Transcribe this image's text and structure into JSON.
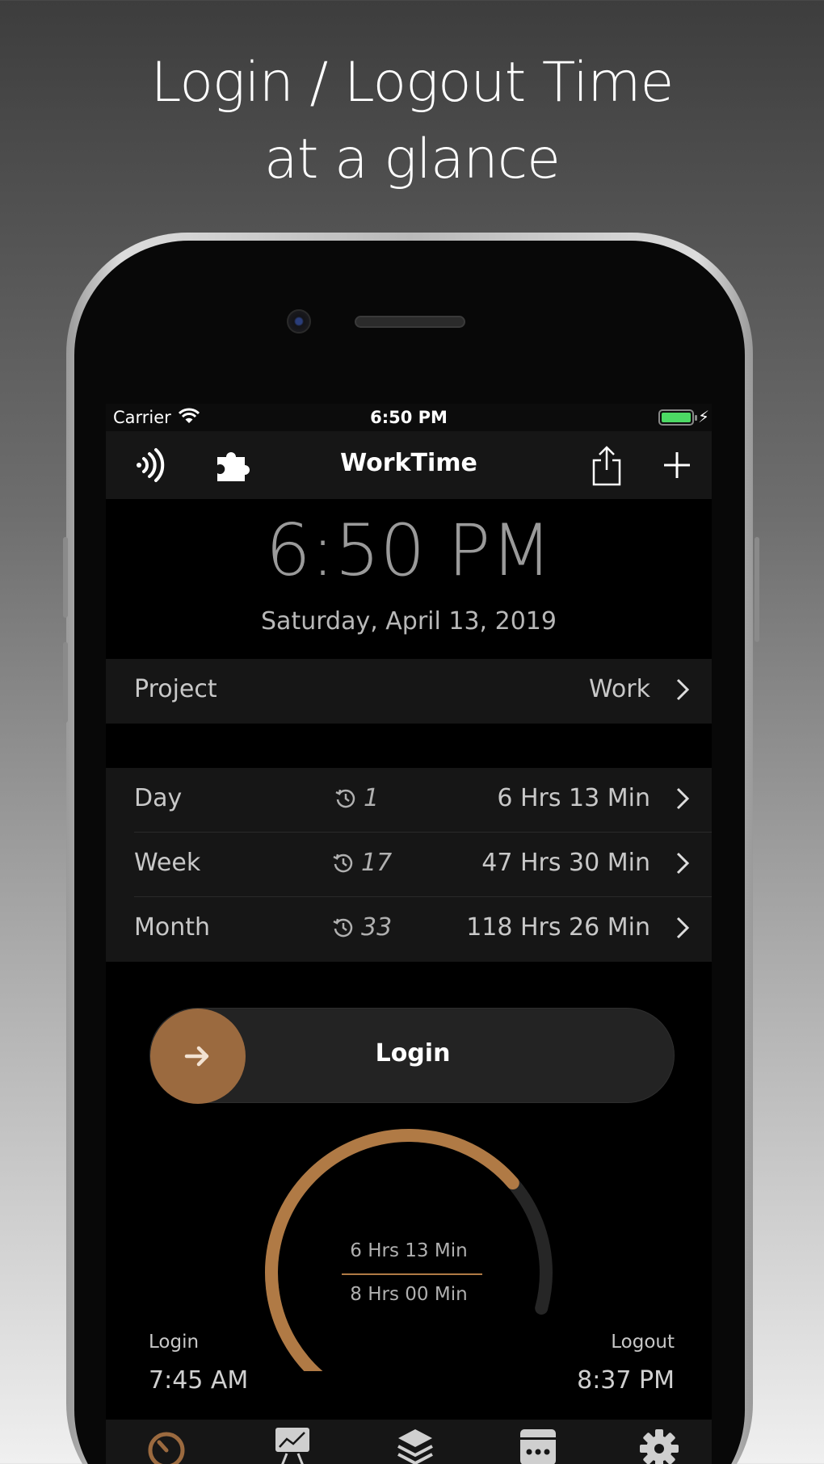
{
  "headline": {
    "line1": "Login / Logout Time",
    "line2": "at a glance"
  },
  "status_bar": {
    "carrier": "Carrier",
    "time": "6:50 PM"
  },
  "nav": {
    "title": "WorkTime",
    "left_icons": [
      "nfc-icon",
      "puzzle-icon"
    ],
    "right_icons": [
      "share-icon",
      "plus-icon"
    ]
  },
  "clock": {
    "time": "6:50 PM",
    "date": "Saturday, April 13, 2019"
  },
  "project": {
    "label": "Project",
    "value": "Work"
  },
  "summary": [
    {
      "label": "Day",
      "count": "1",
      "total": "6 Hrs 13 Min"
    },
    {
      "label": "Week",
      "count": "17",
      "total": "47 Hrs 30 Min"
    },
    {
      "label": "Month",
      "count": "33",
      "total": "118 Hrs 26 Min"
    }
  ],
  "slider": {
    "label": "Login"
  },
  "gauge": {
    "worked": "6 Hrs 13 Min",
    "target": "8 Hrs 00 Min",
    "progress_fraction": 0.777,
    "color_progress": "#b07a45",
    "color_track": "#262626"
  },
  "login": {
    "label": "Login",
    "time": "7:45 AM"
  },
  "logout": {
    "label": "Logout",
    "time": "8:37 PM"
  },
  "tabs": [
    "timer-icon",
    "chart-icon",
    "layers-icon",
    "calendar-icon",
    "gear-icon"
  ],
  "colors": {
    "accent": "#9b6a3f",
    "battery": "#4cd964"
  }
}
